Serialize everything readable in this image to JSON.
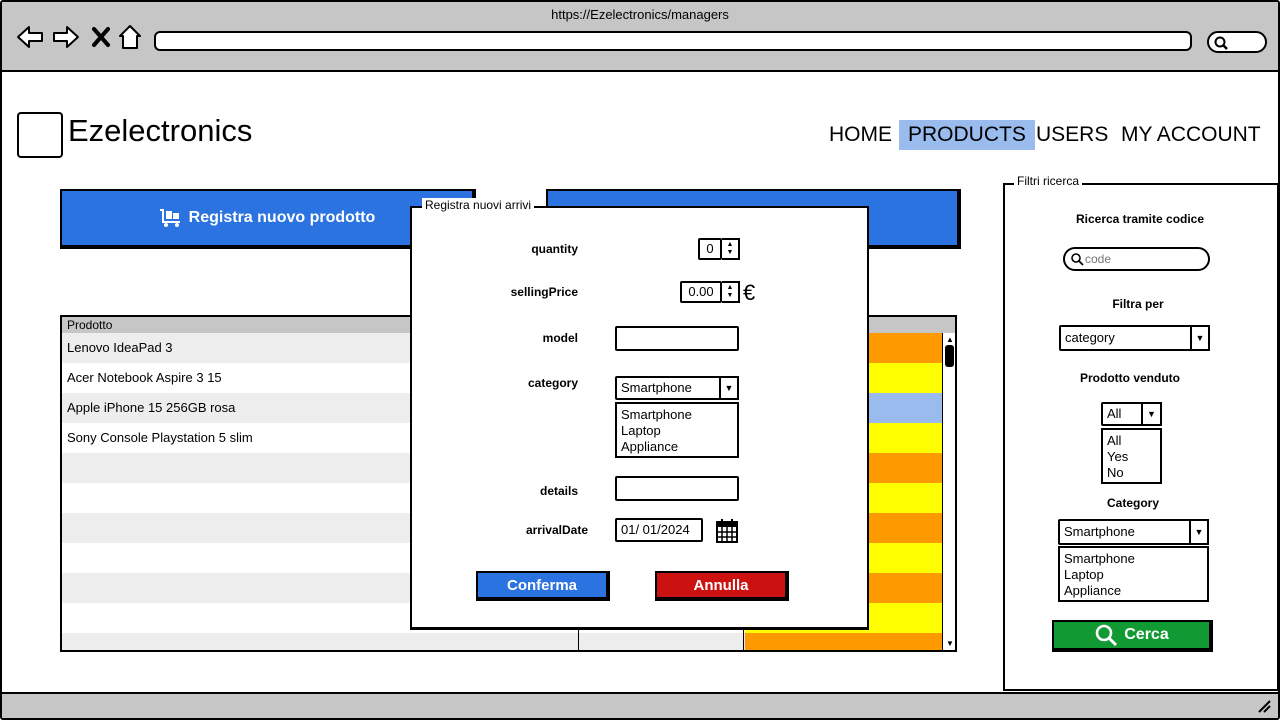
{
  "browser": {
    "url": "https://Ezelectronics/managers"
  },
  "header": {
    "brand": "Ezelectronics",
    "nav": [
      "HOME",
      "PRODUCTS",
      "USERS",
      "MY ACCOUNT"
    ],
    "active_nav": "PRODUCTS"
  },
  "actions": {
    "register_product": "Registra nuovo prodotto"
  },
  "table": {
    "header": "Prodotto",
    "rows": [
      "Lenovo IdeaPad 3",
      "Acer Notebook Aspire 3 15",
      "Apple iPhone 15 256GB rosa",
      "Sony Console Playstation 5 slim"
    ]
  },
  "modal": {
    "title": "Registra nuovi arrivi",
    "quantity_label": "quantity",
    "quantity_value": "0",
    "price_label": "sellingPrice",
    "price_value": "0.00",
    "currency": "€",
    "model_label": "model",
    "model_value": "",
    "category_label": "category",
    "category_selected": "Smartphone",
    "category_options": [
      "Smartphone",
      "Laptop",
      "Appliance"
    ],
    "details_label": "details",
    "details_value": "",
    "date_label": "arrivalDate",
    "date_value": "01/ 01/2024",
    "confirm": "Conferma",
    "cancel": "Annulla"
  },
  "filters": {
    "title": "Filtri ricerca",
    "search_code_label": "Ricerca tramite codice",
    "search_placeholder": "code",
    "filter_by_label": "Filtra per",
    "filter_by_selected": "category",
    "sold_label": "Prodotto venduto",
    "sold_selected": "All",
    "sold_options": [
      "All",
      "Yes",
      "No"
    ],
    "category_label": "Category",
    "category_selected": "Smartphone",
    "category_options": [
      "Smartphone",
      "Laptop",
      "Appliance"
    ],
    "search_button": "Cerca"
  },
  "colors": {
    "accent_blue": "#2b73e0",
    "nav_active": "#99bbee",
    "confirm_blue": "#2b73e0",
    "cancel_red": "#cc1111",
    "search_green": "#119933",
    "row_orange": "#ff9900",
    "row_yellow": "#ffff00",
    "row_lightblue": "#99bbee"
  }
}
